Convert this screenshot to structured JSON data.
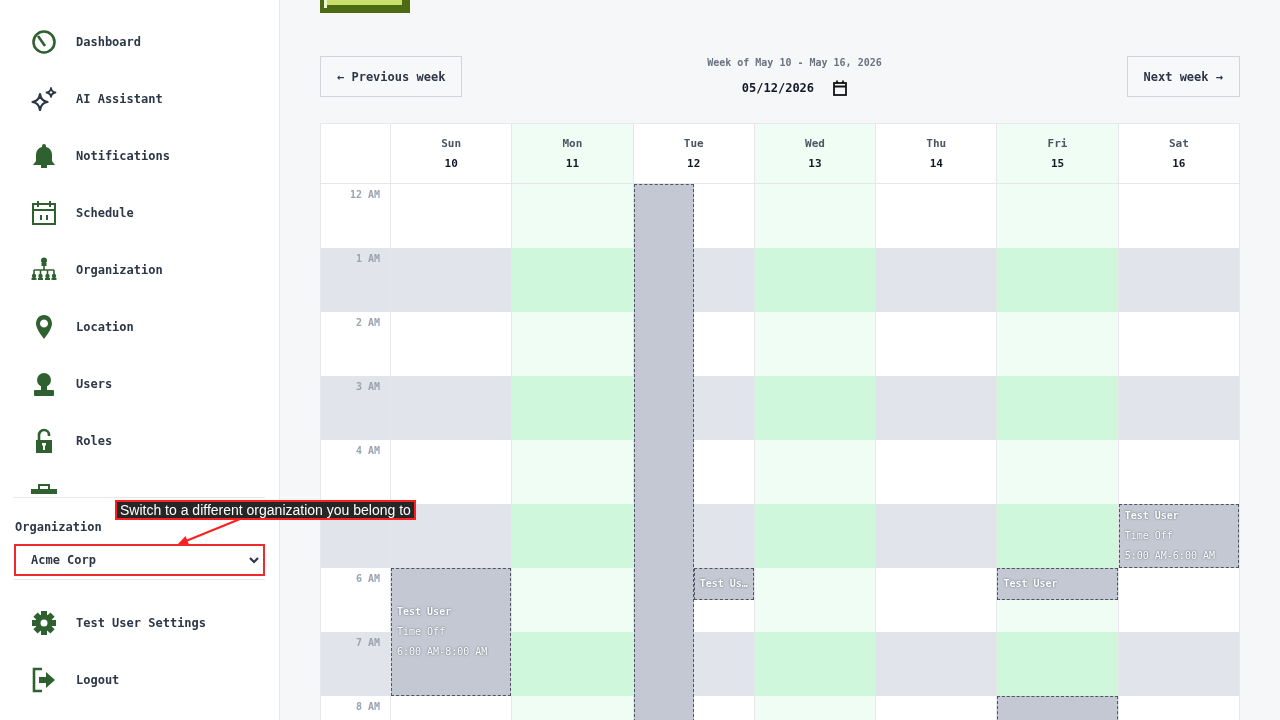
{
  "sidebar": {
    "nav_items": [
      {
        "label": "Dashboard"
      },
      {
        "label": "AI Assistant"
      },
      {
        "label": "Notifications"
      },
      {
        "label": "Schedule"
      },
      {
        "label": "Organization"
      },
      {
        "label": "Location"
      },
      {
        "label": "Users"
      },
      {
        "label": "Roles"
      }
    ],
    "organization": {
      "label": "Organization",
      "select": {
        "value": "Acme Corp",
        "highlighted": true
      }
    },
    "footer_items": [
      {
        "label": "Test User Settings"
      },
      {
        "label": "Logout"
      }
    ]
  },
  "annotation": {
    "text": "Switch to a different organization you belong to"
  },
  "week_nav": {
    "previous": "← Previous week",
    "title": "Week of May 10 - May 16, 2026",
    "date": "05/12/2026",
    "next": "Next week →"
  },
  "calendar": {
    "hours": [
      {
        "label": "12 AM",
        "shaded": false
      },
      {
        "label": "1 AM",
        "shaded": true
      },
      {
        "label": "2 AM",
        "shaded": false
      },
      {
        "label": "3 AM",
        "shaded": true
      },
      {
        "label": "4 AM",
        "shaded": false
      },
      {
        "shaded": true
      },
      {
        "label": "6 AM",
        "shaded": false
      },
      {
        "label": "7 AM",
        "shaded": true
      },
      {
        "label": "8 AM",
        "shaded": false
      }
    ],
    "days": [
      {
        "name": "Sun",
        "date": "10",
        "highlighted": false,
        "slots": [
          {
            "shaded": false
          },
          {
            "shaded": true
          },
          {
            "shaded": false
          },
          {
            "shaded": true
          },
          {
            "shaded": false
          },
          {
            "shaded": true
          },
          {
            "events": [
              {
                "kind": "two_hours",
                "name": "Test User",
                "type": "Time Off",
                "time": "6:00 AM-8:00 AM"
              }
            ]
          },
          {
            "shaded": false
          }
        ]
      },
      {
        "name": "Mon",
        "date": "11",
        "highlighted": true,
        "slots": [
          {
            "shaded": false
          },
          {
            "shaded": true
          },
          {
            "shaded": false
          },
          {
            "shaded": true
          },
          {
            "shaded": false
          },
          {
            "shaded": true
          },
          {
            "shaded": false
          },
          {
            "shaded": true
          },
          {
            "shaded": false
          }
        ]
      },
      {
        "name": "Tue",
        "date": "12",
        "highlighted": false,
        "slots": [
          {
            "shaded": false,
            "events": [
              {
                "kind": "extended"
              }
            ]
          },
          {
            "shaded": true
          },
          {
            "shaded": false
          },
          {
            "shaded": true
          },
          {
            "shaded": false
          },
          {
            "shaded": true
          },
          {
            "shaded": false,
            "events": [
              {
                "kind": "half_hour",
                "name": "Test Us…"
              }
            ]
          },
          {
            "shaded": true
          },
          {
            "shaded": false
          }
        ]
      },
      {
        "name": "Wed",
        "date": "13",
        "highlighted": true,
        "slots": [
          {
            "shaded": false
          },
          {
            "shaded": true
          },
          {
            "shaded": false
          },
          {
            "shaded": true
          },
          {
            "shaded": false
          },
          {
            "shaded": true
          },
          {
            "shaded": false
          },
          {
            "shaded": true
          },
          {
            "shaded": false
          }
        ]
      },
      {
        "name": "Thu",
        "date": "14",
        "highlighted": false,
        "slots": [
          {
            "shaded": false
          },
          {
            "shaded": true
          },
          {
            "shaded": false
          },
          {
            "shaded": true
          },
          {
            "shaded": false
          },
          {
            "shaded": true
          },
          {
            "shaded": false
          },
          {
            "shaded": true
          },
          {
            "shaded": false
          }
        ]
      },
      {
        "name": "Fri",
        "date": "15",
        "highlighted": true,
        "slots": [
          {
            "shaded": false
          },
          {
            "shaded": true
          },
          {
            "shaded": false
          },
          {
            "shaded": true
          },
          {
            "shaded": false
          },
          {
            "shaded": true
          },
          {
            "shaded": false,
            "events": [
              {
                "kind": "half_hour",
                "name": "Test User"
              }
            ]
          },
          {
            "shaded": true
          },
          {
            "events": [
              {
                "kind": "hour"
              }
            ]
          }
        ]
      },
      {
        "name": "Sat",
        "date": "16",
        "highlighted": false,
        "slots": [
          {
            "shaded": false
          },
          {
            "shaded": true
          },
          {
            "shaded": false
          },
          {
            "shaded": true
          },
          {
            "shaded": false
          },
          {
            "events": [
              {
                "kind": "hour",
                "name": "Test User",
                "type": "Time Off",
                "time": "5:00 AM-6:00 AM"
              }
            ]
          },
          {
            "shaded": false
          },
          {
            "shaded": true
          },
          {
            "shaded": false
          }
        ]
      }
    ]
  }
}
